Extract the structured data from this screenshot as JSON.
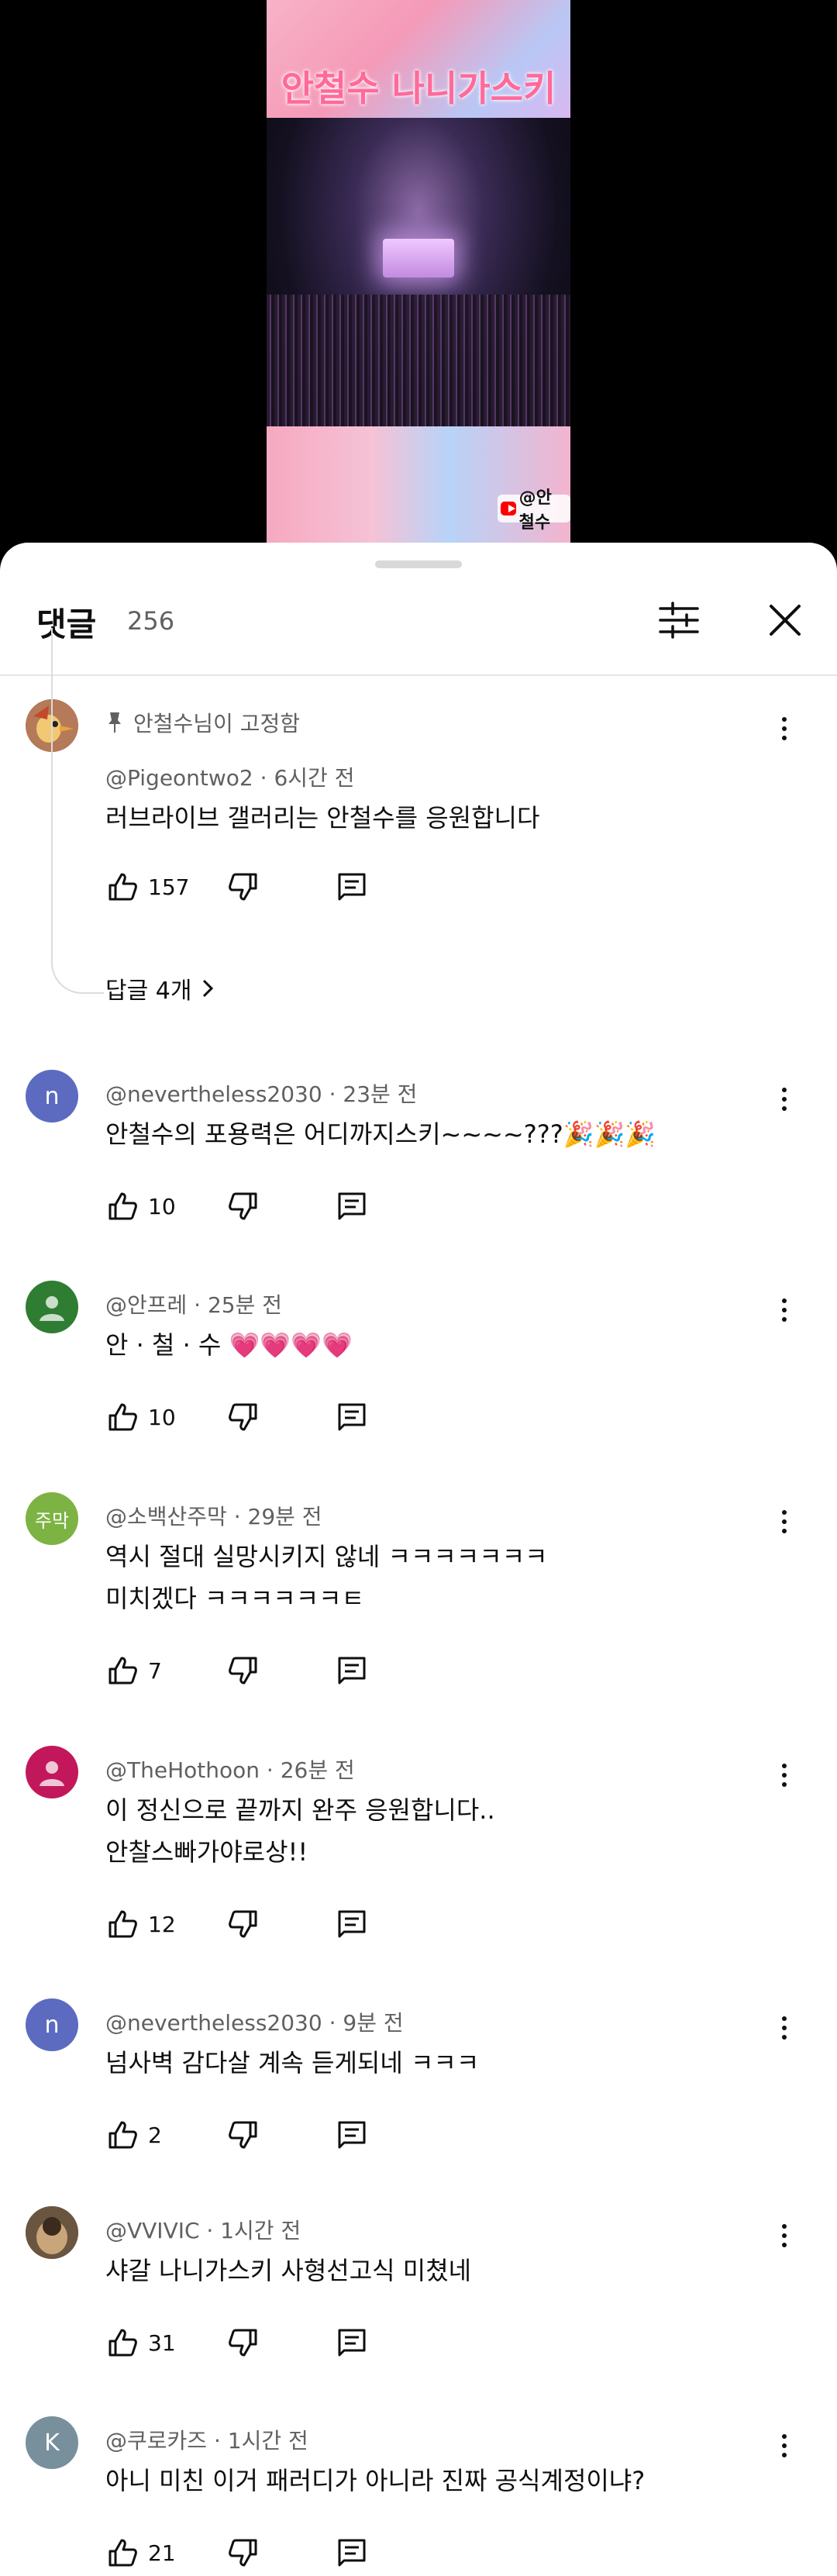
{
  "video": {
    "title_overlay": "안철수 나니가스키",
    "channel_badge": "@안철수"
  },
  "header": {
    "title": "댓글",
    "count": "256"
  },
  "pinned_label": "안철수님이 고정함",
  "replies_label": "답글 4개",
  "comments": [
    {
      "author": "@Pigeontwo2",
      "time": "6시간 전",
      "lines": [
        "러브라이브 갤러리는 안철수를 응원합니다"
      ],
      "likes": "157"
    },
    {
      "author": "@nevertheless2030",
      "time": "23분 전",
      "lines": [
        "안철수의 포용력은 어디까지스키~~~~???🎉🎉🎉"
      ],
      "likes": "10",
      "avatar_letter": "n",
      "avatar_color": "#5c6bc0"
    },
    {
      "author": "@안프레",
      "time": "25분 전",
      "lines": [
        "안 · 철 · 수 💗💗💗💗"
      ],
      "likes": "10",
      "avatar_color": "#2e7d32"
    },
    {
      "author": "@소백산주막",
      "time": "29분 전",
      "lines": [
        "역시 절대 실망시키지 않네 ㅋㅋㅋㅋㅋㅋㅋ",
        "미치겠다 ㅋㅋㅋㅋㅋㅋㅌ"
      ],
      "likes": "7",
      "avatar_letter": "주막",
      "avatar_color": "#7cb342"
    },
    {
      "author": "@TheHothoon",
      "time": "26분 전",
      "lines": [
        "이 정신으로 끝까지 완주 응원합니다..",
        "안찰스빠가야로상!!"
      ],
      "likes": "12",
      "avatar_color": "#c2185b"
    },
    {
      "author": "@nevertheless2030",
      "time": "9분 전",
      "lines": [
        "넘사벽 감다살 계속 듣게되네 ㅋㅋㅋ"
      ],
      "likes": "2",
      "avatar_letter": "n",
      "avatar_color": "#5c6bc0"
    },
    {
      "author": "@VVIVIC",
      "time": "1시간 전",
      "lines": [
        "샤갈 나니가스키 사형선고식 미쳤네"
      ],
      "likes": "31"
    },
    {
      "author": "@쿠로카즈",
      "time": "1시간 전",
      "lines": [
        "아니 미친 이거 패러디가 아니라 진짜 공식계정이냐?"
      ],
      "likes": "21",
      "avatar_letter": "K",
      "avatar_color": "#78909c"
    }
  ]
}
